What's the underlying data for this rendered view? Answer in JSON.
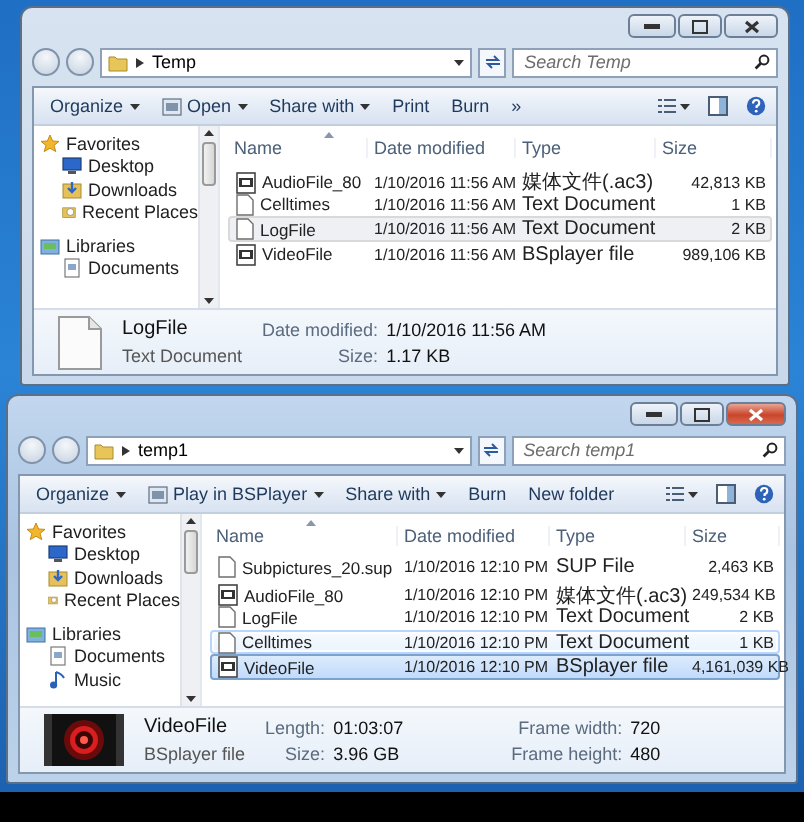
{
  "windows": [
    {
      "active": false,
      "address": "Temp",
      "search": {
        "placeholder": "Search Temp"
      },
      "toolbar": [
        {
          "label": "Organize",
          "kind": "plain",
          "dropdown": true
        },
        {
          "label": "Open",
          "kind": "app",
          "dropdown": true
        },
        {
          "label": "Share with",
          "kind": "plain",
          "dropdown": true
        },
        {
          "label": "Print",
          "kind": "plain",
          "dropdown": false
        },
        {
          "label": "Burn",
          "kind": "plain",
          "dropdown": false
        },
        {
          "label": "»",
          "kind": "plain",
          "dropdown": false
        }
      ],
      "sidebar": [
        {
          "label": "Favorites",
          "kind": "star",
          "children": [
            {
              "label": "Desktop",
              "kind": "desktop"
            },
            {
              "label": "Downloads",
              "kind": "downloads"
            },
            {
              "label": "Recent Places",
              "kind": "recent"
            }
          ]
        },
        {
          "label": "Libraries",
          "kind": "libraries",
          "children": [
            {
              "label": "Documents",
              "kind": "documents"
            }
          ]
        }
      ],
      "columns": [
        "Name",
        "Date modified",
        "Type",
        "Size"
      ],
      "files": [
        {
          "name": "AudioFile_80",
          "date": "1/10/2016 11:56 AM",
          "type": "媒体文件(.ac3)",
          "size": "42,813 KB",
          "kind": "media",
          "selected": false,
          "hovered": false
        },
        {
          "name": "Celltimes",
          "date": "1/10/2016 11:56 AM",
          "type": "Text Document",
          "size": "1 KB",
          "kind": "text",
          "selected": false,
          "hovered": false
        },
        {
          "name": "LogFile",
          "date": "1/10/2016 11:56 AM",
          "type": "Text Document",
          "size": "2 KB",
          "kind": "text",
          "selected": true,
          "hovered": false
        },
        {
          "name": "VideoFile",
          "date": "1/10/2016 11:56 AM",
          "type": "BSplayer file",
          "size": "989,106 KB",
          "kind": "media",
          "selected": false,
          "hovered": false
        }
      ],
      "details": {
        "kind": "text",
        "name": "LogFile",
        "type": "Text Document",
        "fields": [
          {
            "label": "Date modified:",
            "value": "1/10/2016 11:56 AM"
          },
          {
            "label": "Size:",
            "value": "1.17 KB"
          }
        ]
      }
    },
    {
      "active": true,
      "address": "temp1",
      "search": {
        "placeholder": "Search temp1"
      },
      "toolbar": [
        {
          "label": "Organize",
          "kind": "plain",
          "dropdown": true
        },
        {
          "label": "Play in BSPlayer",
          "kind": "app",
          "dropdown": true
        },
        {
          "label": "Share with",
          "kind": "plain",
          "dropdown": true
        },
        {
          "label": "Burn",
          "kind": "plain",
          "dropdown": false
        },
        {
          "label": "New folder",
          "kind": "plain",
          "dropdown": false
        }
      ],
      "sidebar": [
        {
          "label": "Favorites",
          "kind": "star",
          "children": [
            {
              "label": "Desktop",
              "kind": "desktop"
            },
            {
              "label": "Downloads",
              "kind": "downloads"
            },
            {
              "label": "Recent Places",
              "kind": "recent"
            }
          ]
        },
        {
          "label": "Libraries",
          "kind": "libraries",
          "children": [
            {
              "label": "Documents",
              "kind": "documents"
            },
            {
              "label": "Music",
              "kind": "music"
            }
          ]
        }
      ],
      "columns": [
        "Name",
        "Date modified",
        "Type",
        "Size"
      ],
      "files": [
        {
          "name": "Subpictures_20.sup",
          "date": "1/10/2016 12:10 PM",
          "type": "SUP File",
          "size": "2,463 KB",
          "kind": "text",
          "selected": false,
          "hovered": false
        },
        {
          "name": "AudioFile_80",
          "date": "1/10/2016 12:10 PM",
          "type": "媒体文件(.ac3)",
          "size": "249,534 KB",
          "kind": "media",
          "selected": false,
          "hovered": false
        },
        {
          "name": "LogFile",
          "date": "1/10/2016 12:10 PM",
          "type": "Text Document",
          "size": "2 KB",
          "kind": "text",
          "selected": false,
          "hovered": false
        },
        {
          "name": "Celltimes",
          "date": "1/10/2016 12:10 PM",
          "type": "Text Document",
          "size": "1 KB",
          "kind": "text",
          "selected": false,
          "hovered": true
        },
        {
          "name": "VideoFile",
          "date": "1/10/2016 12:10 PM",
          "type": "BSplayer file",
          "size": "4,161,039 KB",
          "kind": "media",
          "selected": true,
          "hovered": false
        }
      ],
      "details": {
        "kind": "video",
        "name": "VideoFile",
        "type": "BSplayer file",
        "fields": [
          {
            "label": "Length:",
            "value": "01:03:07"
          },
          {
            "label": "Size:",
            "value": "3.96 GB"
          },
          {
            "label": "Frame width:",
            "value": "720"
          },
          {
            "label": "Frame height:",
            "value": "480"
          }
        ]
      }
    }
  ]
}
